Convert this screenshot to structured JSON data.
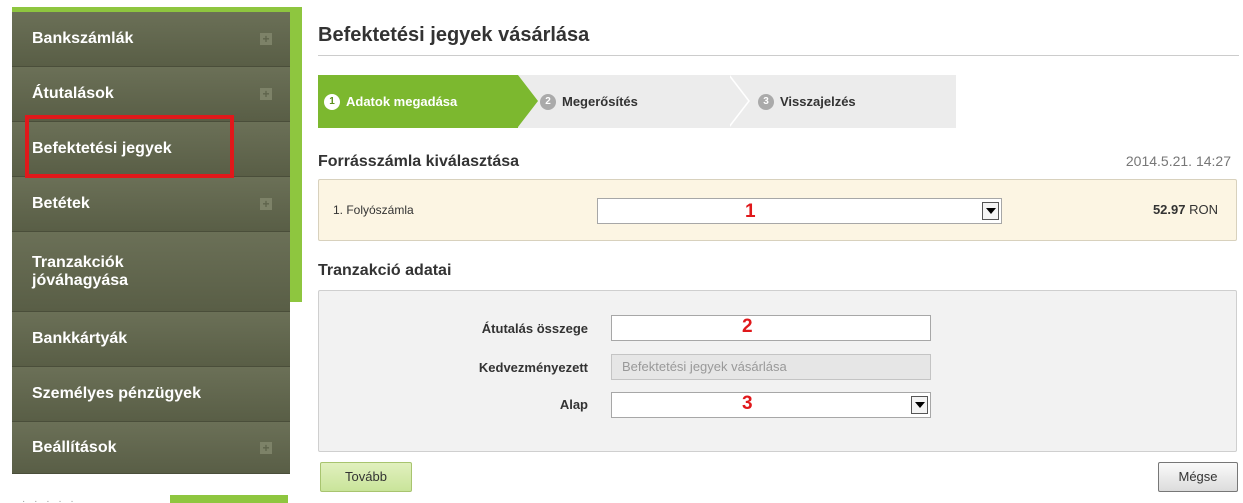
{
  "sidebar": {
    "items": [
      {
        "label": "Bankszámlák",
        "has_plus": true
      },
      {
        "label": "Átutalások",
        "has_plus": true
      },
      {
        "label": "Befektetési jegyek",
        "has_plus": false,
        "highlighted": true
      },
      {
        "label": "Betétek",
        "has_plus": true
      },
      {
        "label": "Tranzakciók jóváhagyása",
        "has_plus": false
      },
      {
        "label": "Bankkártyák",
        "has_plus": false
      },
      {
        "label": "Személyes pénzügyek",
        "has_plus": false
      },
      {
        "label": "Beállítások",
        "has_plus": true
      }
    ]
  },
  "page": {
    "title": "Befektetési jegyek vásárlása"
  },
  "steps": [
    {
      "num": "1",
      "label": "Adatok megadása",
      "active": true
    },
    {
      "num": "2",
      "label": "Megerősítés",
      "active": false
    },
    {
      "num": "3",
      "label": "Visszajelzés",
      "active": false
    }
  ],
  "source": {
    "heading": "Forrásszámla kiválasztása",
    "datetime": "2014.5.21. 14:27",
    "account_label": "1. Folyószámla",
    "marker": "1",
    "balance_amount": "52.97",
    "balance_currency": "RON"
  },
  "transaction": {
    "heading": "Tranzakció adatai",
    "amount_label": "Átutalás összege",
    "amount_marker": "2",
    "payee_label": "Kedvezményezett",
    "payee_value": "Befektetési jegyek vásárlása",
    "fund_label": "Alap",
    "fund_marker": "3"
  },
  "buttons": {
    "next": "Tovább",
    "cancel": "Mégse"
  },
  "colors": {
    "accent_green": "#8ec63f",
    "sidebar_bg": "#5f644c",
    "annotation_red": "#e0181b"
  }
}
